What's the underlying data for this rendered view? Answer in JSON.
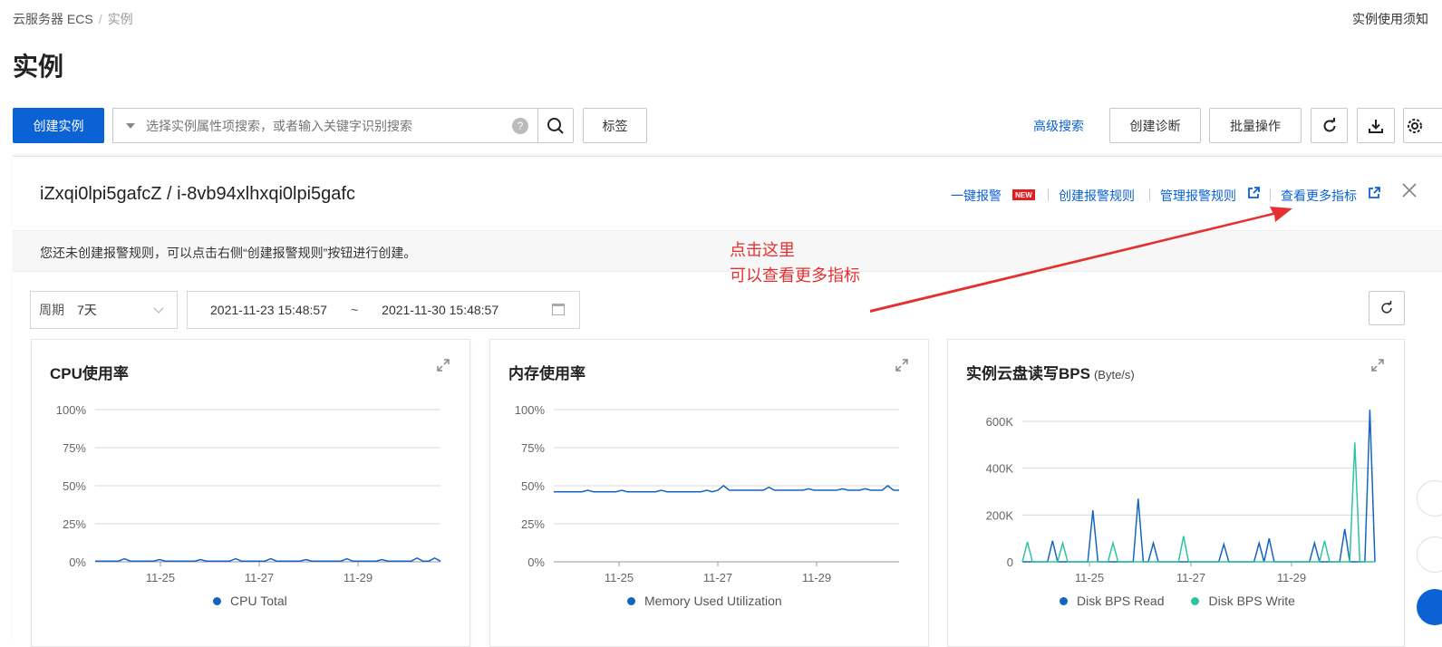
{
  "breadcrumb": {
    "parent": "云服务器 ECS",
    "current": "实例"
  },
  "top_right_text": "实例使用须知",
  "page_title": "实例",
  "toolbar": {
    "create_label": "创建实例",
    "search_placeholder": "选择实例属性项搜索，或者输入关键字识别搜索",
    "help": "?",
    "tag_label": "标签",
    "advanced_search": "高级搜索",
    "diagnose_label": "创建诊断",
    "batch_label": "批量操作"
  },
  "panel": {
    "instance_title": "iZxqi0lpi5gafcZ / i-8vb94xlhxqi0lpi5gafc",
    "links": {
      "one_click_alarm": "一键报警",
      "new_badge": "NEW",
      "create_rule": "创建报警规则",
      "manage_rule": "管理报警规则",
      "more_metrics": "查看更多指标"
    },
    "notice": "您还未创建报警规则，可以点击右侧“创建报警规则”按钮进行创建。",
    "annotation": [
      "点击这里",
      "可以查看更多指标"
    ],
    "period_label": "周期",
    "period_value": "7天",
    "range_start": "2021-11-23 15:48:57",
    "range_sep": "~",
    "range_end": "2021-11-30 15:48:57"
  },
  "colors": {
    "primary": "#0b62d4",
    "series_blue": "#1565c0",
    "series_teal": "#2ec4a0",
    "annotation": "#e53030"
  },
  "chart_data": [
    {
      "type": "line",
      "title": "CPU使用率",
      "x_ticks": [
        "11-25",
        "11-27",
        "11-29"
      ],
      "y_ticks": [
        "100%",
        "75%",
        "50%",
        "25%",
        "0%"
      ],
      "ylim": [
        0,
        100
      ],
      "series": [
        {
          "name": "CPU Total",
          "color": "#1565c0",
          "values": [
            0.5,
            0.5,
            0.5,
            0.5,
            0.5,
            2,
            0.5,
            0.5,
            0.5,
            0.5,
            0.5,
            1.5,
            0.5,
            0.5,
            0.5,
            0.5,
            0.5,
            0.5,
            1.5,
            0.5,
            0.5,
            0.5,
            0.5,
            0.5,
            2,
            0.5,
            0.5,
            0.5,
            0.5,
            0.5,
            2,
            0.5,
            0.5,
            0.5,
            0.5,
            0.5,
            1.5,
            0.5,
            0.5,
            0.5,
            0.5,
            0.5,
            0.5,
            2,
            0.5,
            0.5,
            0.5,
            0.5,
            0.5,
            1.5,
            0.5,
            0.5,
            0.5,
            0.5,
            0.5,
            2.5,
            0.5,
            0.5,
            2.5,
            0.5
          ]
        }
      ]
    },
    {
      "type": "line",
      "title": "内存使用率",
      "x_ticks": [
        "11-25",
        "11-27",
        "11-29"
      ],
      "y_ticks": [
        "100%",
        "75%",
        "50%",
        "25%",
        "0%"
      ],
      "ylim": [
        0,
        100
      ],
      "series": [
        {
          "name": "Memory Used Utilization",
          "color": "#1565c0",
          "values": [
            46,
            46,
            46,
            46,
            46,
            46,
            47,
            46,
            46,
            46,
            46,
            46,
            47,
            46,
            46,
            46,
            46,
            46,
            46,
            47,
            46,
            46,
            46,
            46,
            46,
            46,
            46,
            47,
            46,
            47,
            50,
            47,
            47,
            47,
            47,
            47,
            47,
            47,
            49,
            47,
            47,
            47,
            47,
            47,
            47,
            48,
            47,
            47,
            47,
            47,
            47,
            48,
            47,
            47,
            47,
            48,
            47,
            47,
            47,
            50,
            47,
            47
          ]
        }
      ]
    },
    {
      "type": "line",
      "title": "实例云盘读写BPS",
      "unit": "(Byte/s)",
      "x_ticks": [
        "11-25",
        "11-27",
        "11-29"
      ],
      "y_ticks": [
        "600K",
        "400K",
        "200K",
        "0"
      ],
      "ylim": [
        0,
        600000
      ],
      "series": [
        {
          "name": "Disk BPS Read",
          "color": "#1565c0",
          "values": [
            0,
            0,
            0,
            0,
            0,
            0,
            90000,
            0,
            0,
            0,
            0,
            0,
            0,
            0,
            220000,
            0,
            0,
            0,
            0,
            0,
            0,
            0,
            0,
            270000,
            0,
            0,
            80000,
            0,
            0,
            0,
            0,
            0,
            0,
            0,
            0,
            0,
            0,
            0,
            0,
            0,
            75000,
            0,
            0,
            0,
            0,
            0,
            0,
            80000,
            0,
            100000,
            0,
            0,
            0,
            0,
            0,
            0,
            0,
            0,
            80000,
            0,
            0,
            0,
            0,
            0,
            140000,
            0,
            0,
            0,
            0,
            650000,
            0
          ]
        },
        {
          "name": "Disk BPS Write",
          "color": "#2ec4a0",
          "values": [
            0,
            85000,
            0,
            0,
            0,
            0,
            0,
            0,
            80000,
            0,
            0,
            0,
            0,
            0,
            0,
            0,
            0,
            0,
            80000,
            0,
            0,
            0,
            0,
            0,
            0,
            0,
            0,
            0,
            0,
            0,
            0,
            0,
            110000,
            0,
            0,
            0,
            0,
            0,
            0,
            0,
            0,
            0,
            0,
            0,
            0,
            0,
            0,
            0,
            0,
            0,
            0,
            0,
            0,
            0,
            0,
            0,
            0,
            0,
            0,
            0,
            90000,
            0,
            0,
            0,
            0,
            0,
            510000,
            0,
            0,
            0,
            0
          ]
        }
      ]
    }
  ]
}
